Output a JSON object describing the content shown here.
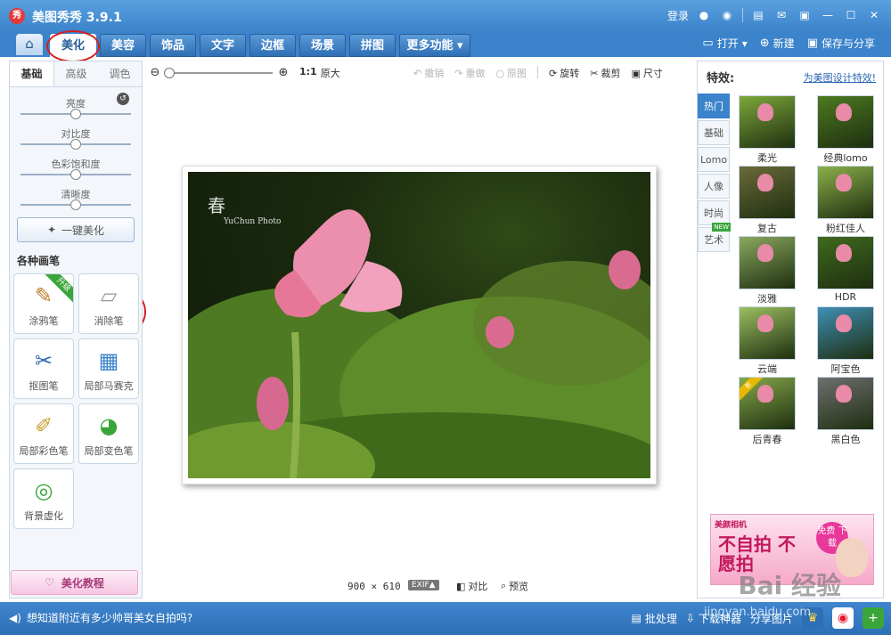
{
  "app": {
    "icon_label": "秀",
    "title": "美图秀秀 3.9.1",
    "login": "登录"
  },
  "tabs": [
    {
      "label": "美化",
      "active": true
    },
    {
      "label": "美容"
    },
    {
      "label": "饰品"
    },
    {
      "label": "文字"
    },
    {
      "label": "边框"
    },
    {
      "label": "场景"
    },
    {
      "label": "拼图"
    },
    {
      "label": "更多功能 ▾"
    }
  ],
  "tab_actions": {
    "open": "打开",
    "new": "新建",
    "save": "保存与分享"
  },
  "left": {
    "sub_tabs": [
      "基础",
      "高级",
      "调色"
    ],
    "sliders": [
      {
        "label": "亮度",
        "value": 0.5
      },
      {
        "label": "对比度",
        "value": 0.5
      },
      {
        "label": "色彩饱和度",
        "value": 0.5
      },
      {
        "label": "清晰度",
        "value": 0.5
      }
    ],
    "one_key": "一键美化",
    "section_title": "各种画笔",
    "brushes": [
      {
        "label": "涂鸦笔",
        "badge": "升级"
      },
      {
        "label": "消除笔"
      },
      {
        "label": "抠图笔"
      },
      {
        "label": "局部马赛克"
      },
      {
        "label": "局部彩色笔"
      },
      {
        "label": "局部变色笔"
      },
      {
        "label": "背景虚化"
      }
    ],
    "tutorial": "美化教程"
  },
  "canvas_toolbar": {
    "ratio_label": "1:1",
    "original": "原大",
    "undo": "撤销",
    "redo": "重做",
    "restore": "原图",
    "rotate": "旋转",
    "crop": "裁剪",
    "resize": "尺寸"
  },
  "canvas": {
    "photo_text": "春",
    "photo_subtext": "YuChun Photo",
    "width": "900",
    "times": "×",
    "height": "610",
    "exif": "EXIF▲",
    "compare": "对比",
    "preview": "预览"
  },
  "right": {
    "title": "特效:",
    "link": "为美图设计特效!",
    "categories": [
      {
        "label": "热门",
        "active": true
      },
      {
        "label": "基础"
      },
      {
        "label": "Lomo"
      },
      {
        "label": "人像"
      },
      {
        "label": "时尚"
      },
      {
        "label": "艺术",
        "new": "NEW"
      }
    ],
    "effects": [
      {
        "label": "柔光",
        "tint": "#7da83a"
      },
      {
        "label": "经典lomo",
        "tint": "#4d7a20"
      },
      {
        "label": "复古",
        "tint": "#6b6a3a"
      },
      {
        "label": "粉红佳人",
        "tint": "#8bb04a"
      },
      {
        "label": "淡雅",
        "tint": "#8aa85e"
      },
      {
        "label": "HDR",
        "tint": "#3f6a1e"
      },
      {
        "label": "云端",
        "tint": "#9bbf60"
      },
      {
        "label": "阿宝色",
        "tint": "#3f8fb5"
      },
      {
        "label": "后青春",
        "tint": "#86a84a",
        "badge": "新"
      },
      {
        "label": "黑白色",
        "tint": "#6f6f6f"
      }
    ],
    "ad": {
      "brand": "美颜相机",
      "headline": "不自拍 不愿拍",
      "free": "免费 下载"
    }
  },
  "status": {
    "message": "想知道附近有多少帅哥美女自拍吗?",
    "batch": "批处理",
    "download": "下载神器",
    "share": "分享图片"
  },
  "watermark": {
    "baidu": "Bai 经验",
    "site": "jingyan.baidu.com"
  }
}
